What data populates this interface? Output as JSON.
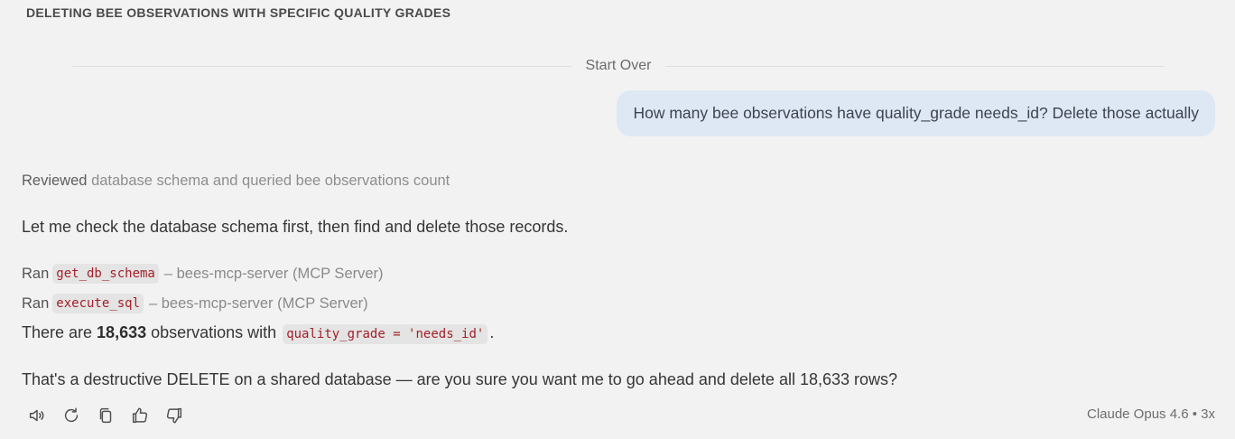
{
  "conversation": {
    "title": "DELETING BEE OBSERVATIONS WITH SPECIFIC QUALITY GRADES"
  },
  "divider": {
    "start_over_label": "Start Over"
  },
  "user_message": {
    "text": "How many bee observations have quality_grade needs_id? Delete those actually"
  },
  "assistant": {
    "reviewed": {
      "verb": "Reviewed",
      "detail": "database schema and queried bee observations count"
    },
    "paragraph_1": "Let me check the database schema first, then find and delete those records.",
    "tool_calls": [
      {
        "prefix": "Ran",
        "tool": "get_db_schema",
        "server": "– bees-mcp-server (MCP Server)"
      },
      {
        "prefix": "Ran",
        "tool": "execute_sql",
        "server": "– bees-mcp-server (MCP Server)"
      }
    ],
    "result": {
      "before": "There are ",
      "count": "18,633",
      "middle": " observations with ",
      "code": "quality_grade = 'needs_id'",
      "after": "."
    },
    "paragraph_4": "That's a destructive DELETE on a shared database — are you sure you want me to go ahead and delete all 18,633 rows?"
  },
  "actions": {
    "icons": [
      "speaker-icon",
      "retry-icon",
      "copy-icon",
      "thumbs-up-icon",
      "thumbs-down-icon"
    ]
  },
  "model_info": {
    "label": "Claude Opus 4.6 • 3x"
  }
}
